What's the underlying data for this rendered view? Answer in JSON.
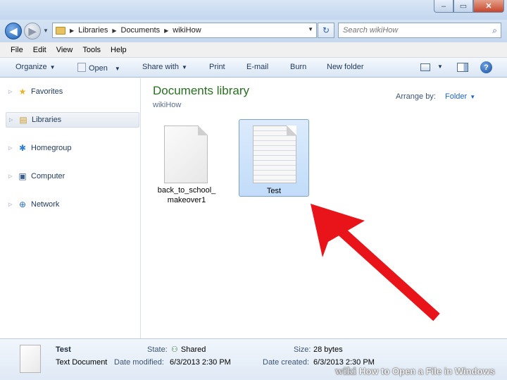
{
  "window": {
    "min_glyph": "–",
    "max_glyph": "▭",
    "close_glyph": "✕"
  },
  "address_bar": {
    "crumbs": [
      "Libraries",
      "Documents",
      "wikiHow"
    ],
    "search_placeholder": "Search wikiHow"
  },
  "menu": [
    "File",
    "Edit",
    "View",
    "Tools",
    "Help"
  ],
  "toolbar": {
    "organize": "Organize",
    "open": "Open",
    "share_with": "Share with",
    "print": "Print",
    "email": "E-mail",
    "burn": "Burn",
    "new_folder": "New folder"
  },
  "nav": {
    "favorites": "Favorites",
    "libraries": "Libraries",
    "homegroup": "Homegroup",
    "computer": "Computer",
    "network": "Network"
  },
  "content": {
    "library_title": "Documents library",
    "library_subtitle": "wikiHow",
    "arrange_label": "Arrange by:",
    "arrange_value": "Folder",
    "files": [
      {
        "name_line1": "back_to_school_",
        "name_line2": "makeover1",
        "selected": false
      },
      {
        "name_line1": "Test",
        "name_line2": "",
        "selected": true
      }
    ]
  },
  "details": {
    "name": "Test",
    "type": "Text Document",
    "state_label": "State:",
    "state_value": "Shared",
    "modified_label": "Date modified:",
    "modified_value": "6/3/2013 2:30 PM",
    "size_label": "Size:",
    "size_value": "28 bytes",
    "created_label": "Date created:",
    "created_value": "6/3/2013 2:30 PM"
  },
  "watermark": {
    "brand": "wiki",
    "text": "How to Open a File in Windows"
  },
  "colors": {
    "library_title": "#2a6e23",
    "annotation_arrow": "#e8141a",
    "selection": "#c1dcfa"
  }
}
